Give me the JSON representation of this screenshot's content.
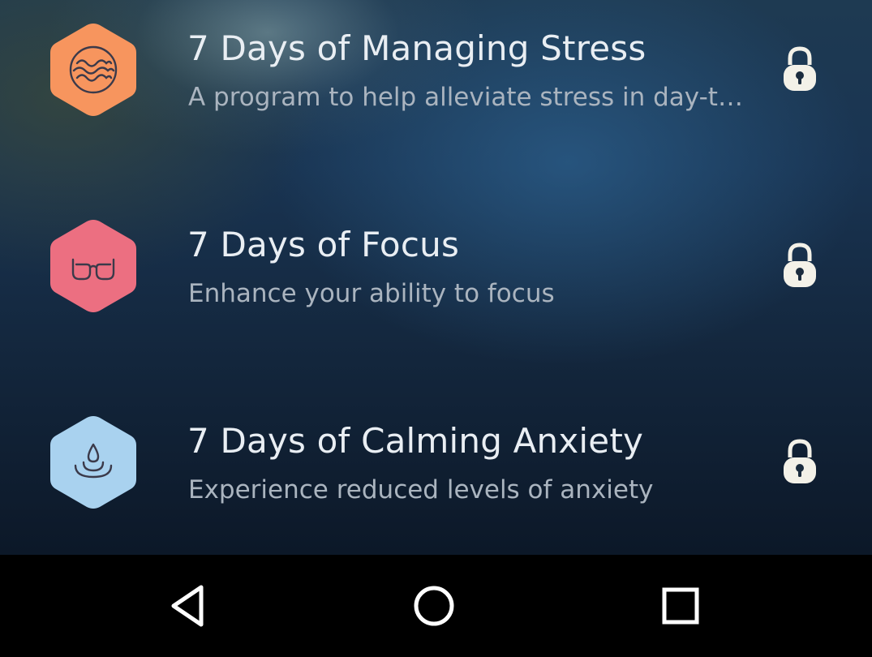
{
  "programs": [
    {
      "title": "7 Days of Managing Stress",
      "subtitle": "A program to help alleviate stress in day-t…",
      "icon": "waves-icon",
      "color": "#f7955e",
      "locked": true
    },
    {
      "title": "7 Days of Focus",
      "subtitle": "Enhance your ability to focus",
      "icon": "glasses-icon",
      "color": "#ec6f81",
      "locked": true
    },
    {
      "title": "7 Days of Calming Anxiety",
      "subtitle": "Experience reduced levels of anxiety",
      "icon": "water-drop-icon",
      "color": "#a9d2ef",
      "locked": true
    }
  ],
  "navbar": {
    "back_icon": "back-triangle-icon",
    "home_icon": "home-circle-icon",
    "recents_icon": "recents-square-icon"
  },
  "colors": {
    "lock": "#f3f1e8",
    "glyph_stroke": "#3b3a4a"
  }
}
